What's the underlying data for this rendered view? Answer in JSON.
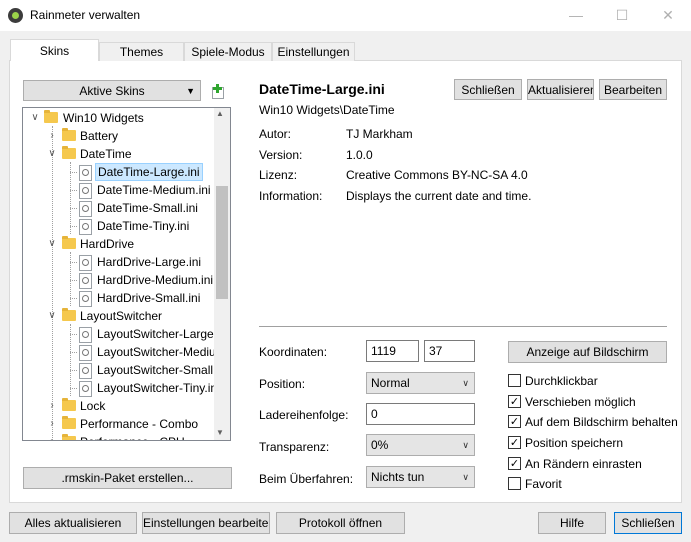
{
  "window": {
    "title": "Rainmeter verwalten"
  },
  "tabs": [
    {
      "label": "Skins"
    },
    {
      "label": "Themes"
    },
    {
      "label": "Spiele-Modus"
    },
    {
      "label": "Einstellungen"
    }
  ],
  "skins_dropdown": {
    "label": "Aktive Skins"
  },
  "tree": {
    "items": [
      "Win10 Widgets",
      "Battery",
      "DateTime",
      "DateTime-Large.ini",
      "DateTime-Medium.ini",
      "DateTime-Small.ini",
      "DateTime-Tiny.ini",
      "HardDrive",
      "HardDrive-Large.ini",
      "HardDrive-Medium.ini",
      "HardDrive-Small.ini",
      "LayoutSwitcher",
      "LayoutSwitcher-Large.ini",
      "LayoutSwitcher-Medium",
      "LayoutSwitcher-Small.ini",
      "LayoutSwitcher-Tiny.ini",
      "Lock",
      "Performance - Combo",
      "Performance - CPU"
    ]
  },
  "create_package_button": ".rmskin-Paket erstellen...",
  "skin": {
    "name": "DateTime-Large.ini",
    "path": "Win10 Widgets\\DateTime",
    "close_button": "Schließen",
    "refresh_button": "Aktualisieren",
    "edit_button": "Bearbeiten",
    "info": [
      {
        "label": "Autor:",
        "value": "TJ Markham"
      },
      {
        "label": "Version:",
        "value": "1.0.0"
      },
      {
        "label": "Lizenz:",
        "value": "Creative Commons BY-NC-SA 4.0"
      },
      {
        "label": "Information:",
        "value": "Displays the current date and time."
      }
    ]
  },
  "settings": {
    "coordinates_label": "Koordinaten:",
    "x": "1119",
    "y": "37",
    "position_label": "Position:",
    "position_value": "Normal",
    "load_order_label": "Ladereihenfolge:",
    "load_order_value": "0",
    "transparency_label": "Transparenz:",
    "transparency_value": "0%",
    "hover_label": "Beim Überfahren:",
    "hover_value": "Nichts tun",
    "display_button": "Anzeige auf Bildschirm",
    "checkboxes": [
      {
        "label": "Durchklickbar",
        "checked": false
      },
      {
        "label": "Verschieben möglich",
        "checked": true
      },
      {
        "label": "Auf dem Bildschirm behalten",
        "checked": true
      },
      {
        "label": "Position speichern",
        "checked": true
      },
      {
        "label": "An Rändern einrasten",
        "checked": true
      },
      {
        "label": "Favorit",
        "checked": false
      }
    ]
  },
  "footer": {
    "refresh_all": "Alles aktualisieren",
    "edit_settings": "Einstellungen bearbeiten",
    "open_log": "Protokoll öffnen",
    "help": "Hilfe",
    "close": "Schließen"
  },
  "colors": {
    "accent": "#0078d7",
    "selection": "#cce8ff",
    "folder": "#f5c84e"
  },
  "icons": {
    "add": "plus-icon",
    "caret": "chevron-down-icon"
  }
}
